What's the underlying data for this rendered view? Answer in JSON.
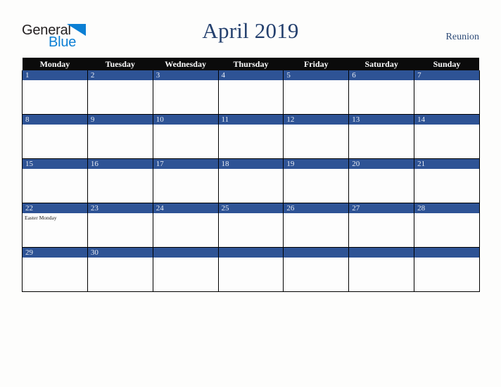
{
  "brand": {
    "name_part1": "General",
    "name_part2": "Blue",
    "triangle_color": "#0b7fd4",
    "text_color": "#231f20"
  },
  "header": {
    "title": "April 2019",
    "region": "Reunion",
    "title_color": "#24406e",
    "region_color": "#2d4a77"
  },
  "calendar": {
    "month": "April",
    "year": "2019",
    "weekday_headers": [
      "Monday",
      "Tuesday",
      "Wednesday",
      "Thursday",
      "Friday",
      "Saturday",
      "Sunday"
    ],
    "header_bg": "#0b0b0b",
    "header_text_color": "#ffffff",
    "daybar_bg": "#2e5395",
    "daynum_color": "#e8ecf4",
    "grid_border_color": "#000000",
    "cell_bg": "#fdfdfd",
    "weeks": [
      [
        {
          "day": "1",
          "events": []
        },
        {
          "day": "2",
          "events": []
        },
        {
          "day": "3",
          "events": []
        },
        {
          "day": "4",
          "events": []
        },
        {
          "day": "5",
          "events": []
        },
        {
          "day": "6",
          "events": []
        },
        {
          "day": "7",
          "events": []
        }
      ],
      [
        {
          "day": "8",
          "events": []
        },
        {
          "day": "9",
          "events": []
        },
        {
          "day": "10",
          "events": []
        },
        {
          "day": "11",
          "events": []
        },
        {
          "day": "12",
          "events": []
        },
        {
          "day": "13",
          "events": []
        },
        {
          "day": "14",
          "events": []
        }
      ],
      [
        {
          "day": "15",
          "events": []
        },
        {
          "day": "16",
          "events": []
        },
        {
          "day": "17",
          "events": []
        },
        {
          "day": "18",
          "events": []
        },
        {
          "day": "19",
          "events": []
        },
        {
          "day": "20",
          "events": []
        },
        {
          "day": "21",
          "events": []
        }
      ],
      [
        {
          "day": "22",
          "events": [
            "Easter Monday"
          ]
        },
        {
          "day": "23",
          "events": []
        },
        {
          "day": "24",
          "events": []
        },
        {
          "day": "25",
          "events": []
        },
        {
          "day": "26",
          "events": []
        },
        {
          "day": "27",
          "events": []
        },
        {
          "day": "28",
          "events": []
        }
      ],
      [
        {
          "day": "29",
          "events": []
        },
        {
          "day": "30",
          "events": []
        },
        {
          "day": "",
          "events": []
        },
        {
          "day": "",
          "events": []
        },
        {
          "day": "",
          "events": []
        },
        {
          "day": "",
          "events": []
        },
        {
          "day": "",
          "events": []
        }
      ]
    ]
  }
}
